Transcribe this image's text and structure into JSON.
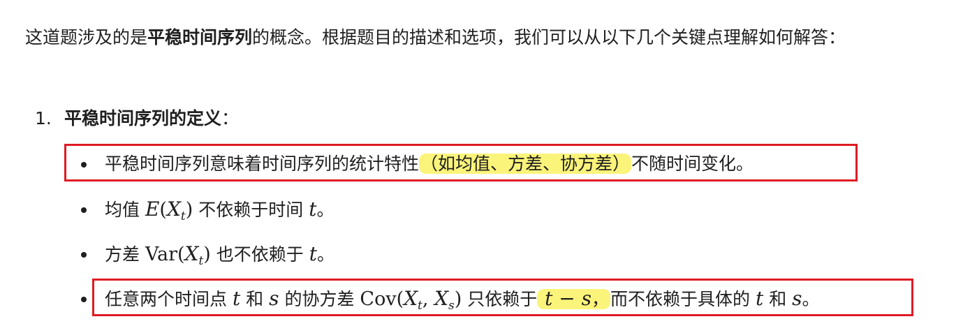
{
  "intro": {
    "pre": "这道题涉及的是",
    "bold": "平稳时间序列",
    "post": "的概念。根据题目的描述和选项，我们可以从以下几个关键点理解如何解答："
  },
  "item1": {
    "number": "1.",
    "title": "平稳时间序列的定义",
    "colon": "："
  },
  "bullets": {
    "b1": {
      "pre": "平稳时间序列意味着时间序列的统计特性",
      "highlight": "（如均值、方差、协方差）",
      "post": "不随时间变化。"
    },
    "b2": {
      "pre": "均值 ",
      "fn": "E",
      "open": "(",
      "var": "X",
      "sub": "t",
      "close": ")",
      "mid": " 不依赖于时间 ",
      "t": "t",
      "end": "。"
    },
    "b3": {
      "pre": "方差 ",
      "fn": "Var(",
      "var": "X",
      "sub": "t",
      "close": ")",
      "mid": " 也不依赖于 ",
      "t": "t",
      "end": "。"
    },
    "b4": {
      "pre": "任意两个时间点 ",
      "t": "t",
      "and1": " 和 ",
      "s": "s",
      "mid1": " 的协方差 ",
      "fn": "Cov(",
      "x1": "X",
      "sub1": "t",
      "comma": ", ",
      "x2": "X",
      "sub2": "s",
      "close": ")",
      "mid2": " 只依赖于",
      "hl_expr": " t − s",
      "hl_comma": "，",
      "mid3": "而不依赖于具体的 ",
      "t2": "t",
      "and2": " 和 ",
      "s2": "s",
      "end": "。"
    }
  },
  "colors": {
    "highlight": "#fbf47a",
    "box_border": "#e01b24",
    "text": "#1f1f1f"
  }
}
